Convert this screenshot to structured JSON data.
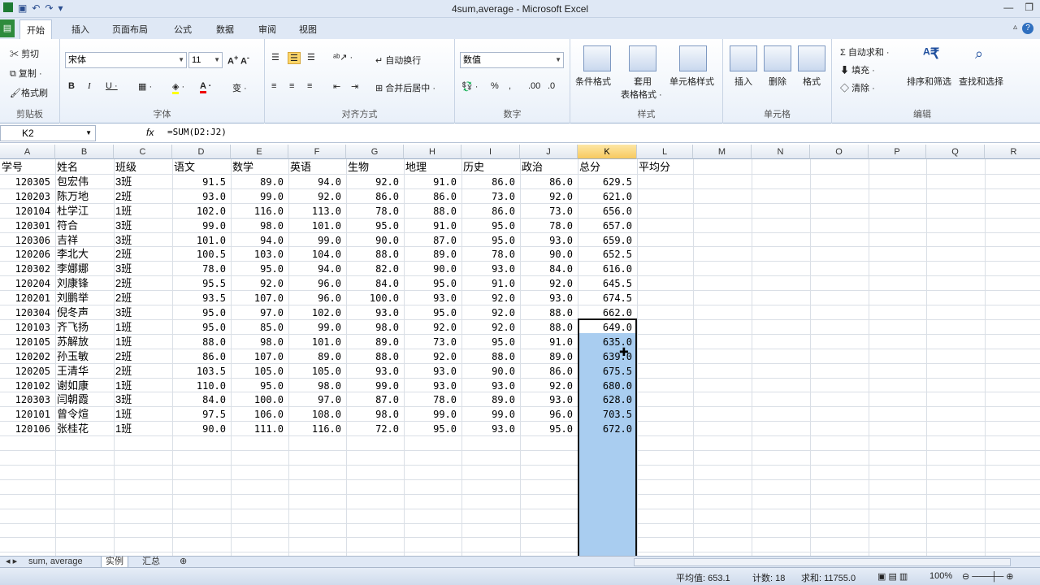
{
  "window": {
    "title": "4sum,average - Microsoft Excel"
  },
  "ribbon_tabs": [
    "开始",
    "插入",
    "页面布局",
    "公式",
    "数据",
    "审阅",
    "视图"
  ],
  "clipboard": {
    "cut": "剪切",
    "copy": "复制 ·",
    "format_painter": "格式刷",
    "group": "剪贴板"
  },
  "font": {
    "name": "宋体",
    "size": "11",
    "group": "字体"
  },
  "alignment": {
    "wrap": "自动换行",
    "merge": "合并后居中 ·",
    "group": "对齐方式"
  },
  "number": {
    "format": "数值",
    "group": "数字"
  },
  "styles": {
    "conditional": "条件格式",
    "table_format_1": "套用",
    "table_format_2": "表格格式 ·",
    "cell_styles": "单元格样式",
    "group": "样式"
  },
  "cells": {
    "insert": "插入",
    "delete": "删除",
    "format": "格式",
    "group": "单元格"
  },
  "editing": {
    "autosum": "自动求和 ·",
    "fill": "填充 ·",
    "clear": "清除 ·",
    "sort": "排序和筛选",
    "find": "查找和选择",
    "group": "编辑"
  },
  "formula_bar": {
    "name_box": "K2",
    "fx": "fx",
    "formula": "=SUM(D2:J2)"
  },
  "columns": [
    "A",
    "B",
    "C",
    "D",
    "E",
    "F",
    "G",
    "H",
    "I",
    "J",
    "K",
    "L",
    "M",
    "N",
    "O",
    "P",
    "Q",
    "R"
  ],
  "headers": [
    "学号",
    "姓名",
    "班级",
    "语文",
    "数学",
    "英语",
    "生物",
    "地理",
    "历史",
    "政治",
    "总分",
    "平均分"
  ],
  "rows": [
    [
      "120305",
      "包宏伟",
      "3班",
      "91.5",
      "89.0",
      "94.0",
      "92.0",
      "91.0",
      "86.0",
      "86.0",
      "629.5"
    ],
    [
      "120203",
      "陈万地",
      "2班",
      "93.0",
      "99.0",
      "92.0",
      "86.0",
      "86.0",
      "73.0",
      "92.0",
      "621.0"
    ],
    [
      "120104",
      "杜学江",
      "1班",
      "102.0",
      "116.0",
      "113.0",
      "78.0",
      "88.0",
      "86.0",
      "73.0",
      "656.0"
    ],
    [
      "120301",
      "符合",
      "3班",
      "99.0",
      "98.0",
      "101.0",
      "95.0",
      "91.0",
      "95.0",
      "78.0",
      "657.0"
    ],
    [
      "120306",
      "吉祥",
      "3班",
      "101.0",
      "94.0",
      "99.0",
      "90.0",
      "87.0",
      "95.0",
      "93.0",
      "659.0"
    ],
    [
      "120206",
      "李北大",
      "2班",
      "100.5",
      "103.0",
      "104.0",
      "88.0",
      "89.0",
      "78.0",
      "90.0",
      "652.5"
    ],
    [
      "120302",
      "李娜娜",
      "3班",
      "78.0",
      "95.0",
      "94.0",
      "82.0",
      "90.0",
      "93.0",
      "84.0",
      "616.0"
    ],
    [
      "120204",
      "刘康锋",
      "2班",
      "95.5",
      "92.0",
      "96.0",
      "84.0",
      "95.0",
      "91.0",
      "92.0",
      "645.5"
    ],
    [
      "120201",
      "刘鹏举",
      "2班",
      "93.5",
      "107.0",
      "96.0",
      "100.0",
      "93.0",
      "92.0",
      "93.0",
      "674.5"
    ],
    [
      "120304",
      "倪冬声",
      "3班",
      "95.0",
      "97.0",
      "102.0",
      "93.0",
      "95.0",
      "92.0",
      "88.0",
      "662.0"
    ],
    [
      "120103",
      "齐飞扬",
      "1班",
      "95.0",
      "85.0",
      "99.0",
      "98.0",
      "92.0",
      "92.0",
      "88.0",
      "649.0"
    ],
    [
      "120105",
      "苏解放",
      "1班",
      "88.0",
      "98.0",
      "101.0",
      "89.0",
      "73.0",
      "95.0",
      "91.0",
      "635.0"
    ],
    [
      "120202",
      "孙玉敏",
      "2班",
      "86.0",
      "107.0",
      "89.0",
      "88.0",
      "92.0",
      "88.0",
      "89.0",
      "639.0"
    ],
    [
      "120205",
      "王清华",
      "2班",
      "103.5",
      "105.0",
      "105.0",
      "93.0",
      "93.0",
      "90.0",
      "86.0",
      "675.5"
    ],
    [
      "120102",
      "谢如康",
      "1班",
      "110.0",
      "95.0",
      "98.0",
      "99.0",
      "93.0",
      "93.0",
      "92.0",
      "680.0"
    ],
    [
      "120303",
      "闫朝霞",
      "3班",
      "84.0",
      "100.0",
      "97.0",
      "87.0",
      "78.0",
      "89.0",
      "93.0",
      "628.0"
    ],
    [
      "120101",
      "曾令煊",
      "1班",
      "97.5",
      "106.0",
      "108.0",
      "98.0",
      "99.0",
      "99.0",
      "96.0",
      "703.5"
    ],
    [
      "120106",
      "张桂花",
      "1班",
      "90.0",
      "111.0",
      "116.0",
      "72.0",
      "95.0",
      "93.0",
      "95.0",
      "672.0"
    ]
  ],
  "sheet_tabs": [
    "sum, average",
    "实例",
    "汇总"
  ],
  "status": {
    "average": "平均值: 653.1",
    "count": "计数: 18",
    "sum": "求和: 11755.0",
    "zoom": "100%"
  }
}
